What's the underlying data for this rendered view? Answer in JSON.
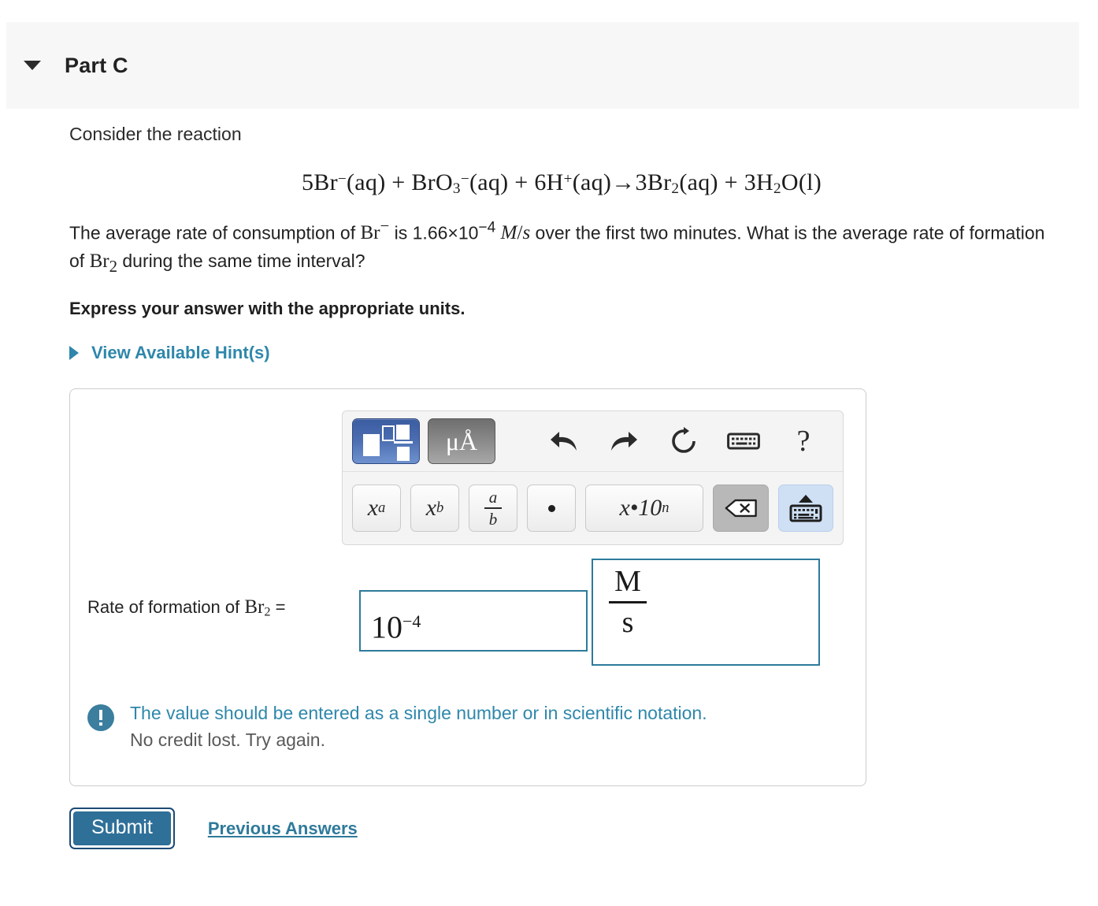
{
  "part_header": {
    "title": "Part C",
    "disclosure_icon": "triangle-down-icon"
  },
  "question": {
    "intro": "Consider the reaction",
    "equation": {
      "full_text": "5Br−(aq) + BrO3−(aq) + 6H+(aq)→3Br2(aq) + 3H2O(l)",
      "parts": {
        "br_coeff": "5Br",
        "br_charge": "−",
        "br_state": "(aq)",
        "plus1": "+",
        "bro3": "BrO",
        "bro3_sub": "3",
        "bro3_charge": "−",
        "bro3_state": "(aq)",
        "plus2": "+",
        "h_coeff": "6H",
        "h_charge": "+",
        "h_state": "(aq)",
        "arrow": "→",
        "br2": "3Br",
        "br2_sub": "2",
        "br2_state": "(aq)",
        "plus3": "+",
        "water": "3H",
        "water_sub": "2",
        "water_o": "O",
        "water_state": "(l)"
      }
    },
    "body_text_1": "The average rate of consumption of ",
    "body_species_1": "Br",
    "body_species_1_charge": "−",
    "body_text_2": " is 1.66×10",
    "body_exponent": "−4",
    "body_units_num": "M",
    "body_units_slash": "/",
    "body_units_den": "s",
    "body_text_3": " over the first two minutes. What is the average rate of formation of ",
    "body_species_2": "Br",
    "body_species_2_sub": "2",
    "body_text_4": " during the same time interval?",
    "express_instruction": "Express your answer with the appropriate units.",
    "hints_label": "View Available Hint(s)",
    "hints_icon": "triangle-right-icon"
  },
  "math_toolbar": {
    "row1": [
      {
        "name": "template-palette-button",
        "icon": "math-template-icon",
        "label": "",
        "state": "selected"
      },
      {
        "name": "units-palette-button",
        "icon": "mu-angstrom-icon",
        "label": "μÅ",
        "state": "normal"
      },
      {
        "name": "undo-button",
        "icon": "undo-arrow-icon",
        "label": ""
      },
      {
        "name": "redo-button",
        "icon": "redo-arrow-icon",
        "label": ""
      },
      {
        "name": "reset-button",
        "icon": "refresh-circle-icon",
        "label": ""
      },
      {
        "name": "keyboard-shortcuts-button",
        "icon": "keyboard-icon",
        "label": ""
      },
      {
        "name": "help-button",
        "icon": "question-mark-icon",
        "label": "?"
      }
    ],
    "row2": [
      {
        "name": "superscript-button",
        "base": "x",
        "sup": "a"
      },
      {
        "name": "subscript-button",
        "base": "x",
        "sub": "b"
      },
      {
        "name": "fraction-button",
        "numerator": "a",
        "denominator": "b"
      },
      {
        "name": "multiplication-dot-button",
        "label": "•"
      },
      {
        "name": "scientific-notation-button",
        "label": "x•10",
        "sup": "n"
      },
      {
        "name": "backspace-button",
        "icon": "backspace-icon"
      },
      {
        "name": "toggle-keyboard-button",
        "icon": "keyboard-up-icon"
      }
    ]
  },
  "answer_area": {
    "rate_label_prefix": "Rate of formation of ",
    "rate_label_species": "Br",
    "rate_label_sub": "2",
    "rate_label_equals": " = ",
    "value_base": "10",
    "value_exponent": "−4",
    "units_numerator": "M",
    "units_denominator": "s"
  },
  "feedback": {
    "icon": "alert-exclamation-icon",
    "line1": "The value should be entered as a single number or in scientific notation.",
    "line2": "No credit lost. Try again."
  },
  "actions": {
    "submit_label": "Submit",
    "previous_answers_label": "Previous Answers"
  },
  "colors": {
    "accent_teal": "#2e87ab",
    "input_border": "#2e7a9b",
    "submit_fill": "#2f7099",
    "submit_ring": "#1d4a75",
    "header_band": "#f7f7f7",
    "alert_icon": "#3b7e9e",
    "template_button_blue": "#4a6cb0"
  }
}
